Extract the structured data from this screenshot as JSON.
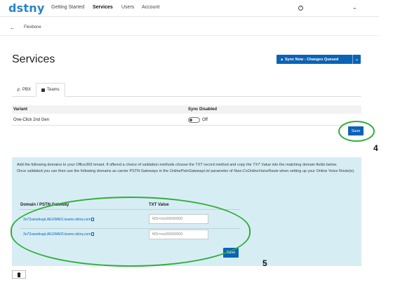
{
  "app": {
    "logo": "dstny"
  },
  "nav": {
    "items": [
      {
        "label": "Getting Started",
        "active": false
      },
      {
        "label": "Services",
        "active": true
      },
      {
        "label": "Users",
        "active": false
      },
      {
        "label": "Account",
        "active": false
      }
    ],
    "help_icon": "help-circle-icon",
    "menu_icon": "chevron-down-icon"
  },
  "breadcrumb": {
    "back_icon": "arrow-left-icon",
    "item": "Flexbone"
  },
  "page": {
    "title": "Services"
  },
  "sync_button": {
    "label": "Sync Now - Changes Queued",
    "icon": "upload-icon",
    "dropdown_icon": "chevron-down-icon"
  },
  "tabs": [
    {
      "label": "PBX",
      "icon": "phone-icon",
      "active": false
    },
    {
      "label": "Teams",
      "icon": "teams-icon",
      "active": true
    }
  ],
  "variant_table": {
    "headers": [
      "Variant",
      "Sync Disabled"
    ],
    "rows": [
      {
        "variant": "One-Click 2nd Gen",
        "sync_disabled": "Off"
      }
    ]
  },
  "save_label": "Save",
  "annotations": {
    "step_a": "4",
    "step_b": "5",
    "color": "#2fae3a"
  },
  "info": {
    "line1_a": "Add the following domains to your Office365 tenant. If offered a choice of validation methods choose the TXT record method and copy the ",
    "line1_em": "TXT Value",
    "line1_b": " into the matching domain fields below.",
    "line2_a": "Once validated you can then use the following domains as carrier PSTN Gateways in the ",
    "line2_em1": "OnlinePstnGatewayList",
    "line2_b": " parameter of ",
    "line2_em2": "New-CsOnlineVoiceRoute",
    "line2_c": " when setting up your Online Voice Route(s)."
  },
  "domain_table": {
    "headers": [
      "Domain / PSTN Gateway",
      "TXT Value"
    ],
    "rows": [
      {
        "domain": "3o72uwsdnupLAEUWA01.teams.dstny.com",
        "placeholder": "MS=ms00000000"
      },
      {
        "domain": "3o72uwsdnupLAEUWA03.teams.dstny.com",
        "placeholder": "MS=ms00000000"
      }
    ]
  },
  "delete_icon": "trash-icon",
  "colors": {
    "primary": "#0b63b6",
    "panel": "#d7edf4",
    "logo": "#2a86c6"
  }
}
